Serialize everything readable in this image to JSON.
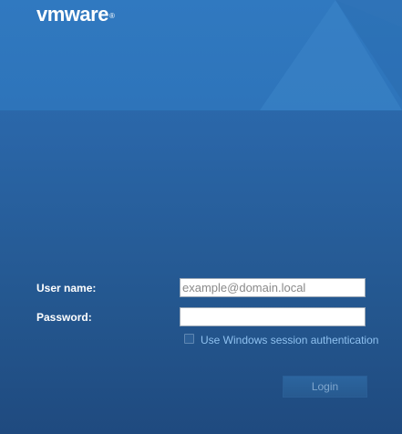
{
  "brand": {
    "logo_text": "vmware",
    "registered_mark": "®"
  },
  "form": {
    "username_label": "User name:",
    "username_placeholder": "example@domain.local",
    "username_value": "",
    "password_label": "Password:",
    "password_value": "",
    "windows_auth_label": "Use Windows session authentication",
    "windows_auth_checked": false,
    "login_label": "Login",
    "login_enabled": false
  },
  "colors": {
    "background": "#2a66a8",
    "link_text": "#8ec0ef",
    "label_text": "#ffffff"
  }
}
